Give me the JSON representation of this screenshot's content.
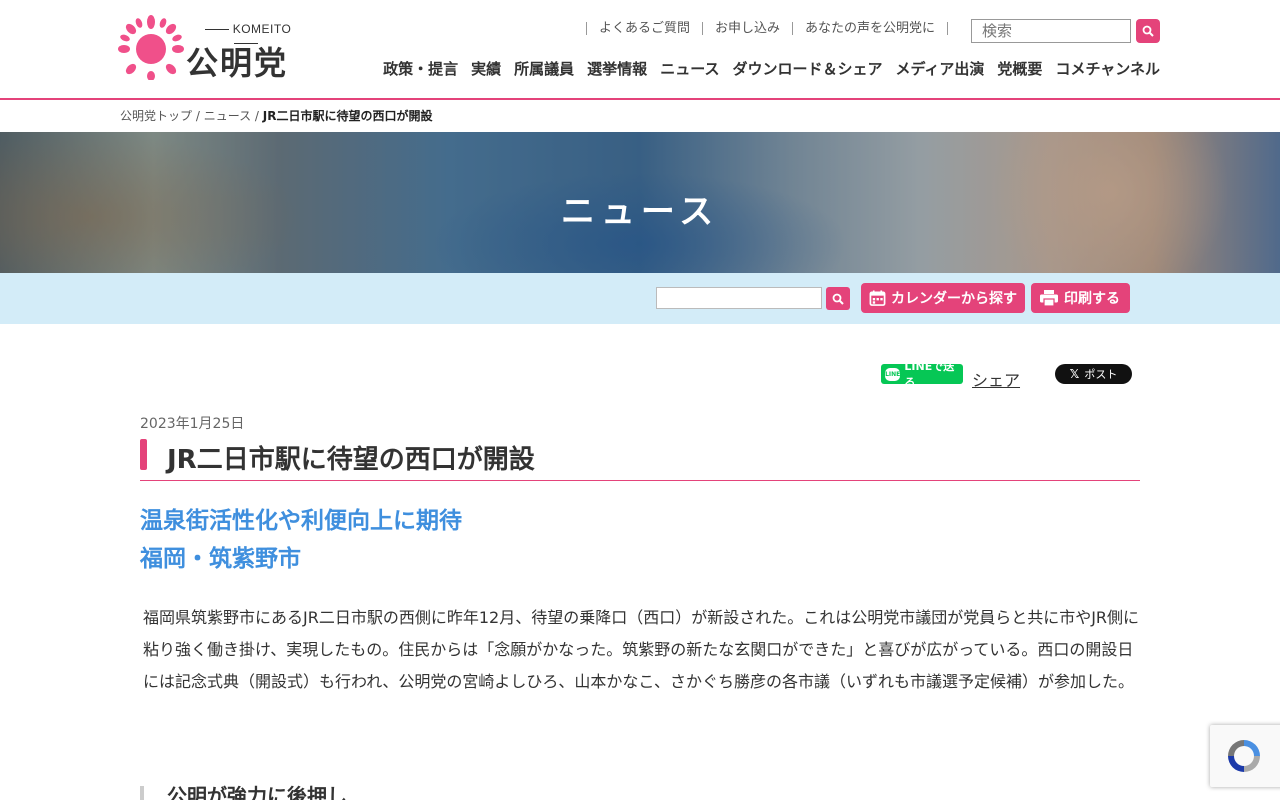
{
  "site": {
    "logo_en": "KOMEITO",
    "logo_ja": "公明党",
    "brand_color": "#e4437a",
    "accent_blue": "#3f8fde"
  },
  "utility_nav": [
    "よくあるご質問",
    "お申し込み",
    "あなたの声を公明党に"
  ],
  "search": {
    "placeholder": "検索",
    "icon": "search-icon"
  },
  "global_nav": [
    "政策・提言",
    "実績",
    "所属議員",
    "選挙情報",
    "ニュース",
    "ダウンロード＆シェア",
    "メディア出演",
    "党概要",
    "コメチャンネル"
  ],
  "breadcrumb": {
    "home": "公明党トップ",
    "sep": " / ",
    "section": "ニュース",
    "current": "JR二日市駅に待望の西口が開設"
  },
  "hero": {
    "title": "ニュース"
  },
  "toolbar": {
    "calendar_label": "カレンダーから探す",
    "print_label": "印刷する"
  },
  "share": {
    "line_label": "LINEで送る",
    "line_logo": "LINE",
    "share_label": "シェア",
    "x_label": "ポスト"
  },
  "article": {
    "date": "2023年1月25日",
    "title": "JR二日市駅に待望の西口が開設",
    "subtitle_line1": "温泉街活性化や利便向上に期待",
    "subtitle_line2": "福岡・筑紫野市",
    "body": "福岡県筑紫野市にあるJR二日市駅の西側に昨年12月、待望の乗降口（西口）が新設された。これは公明党市議団が党員らと共に市やJR側に粘り強く働き掛け、実現したもの。住民からは「念願がかなった。筑紫野の新たな玄関口ができた」と喜びが広がっている。西口の開設日には記念式典（開設式）も行われ、公明党の宮崎よしひろ、山本かなこ、さかぐち勝彦の各市議（いずれも市議選予定候補）が参加した。",
    "section_title": "公明が強力に後押し"
  }
}
